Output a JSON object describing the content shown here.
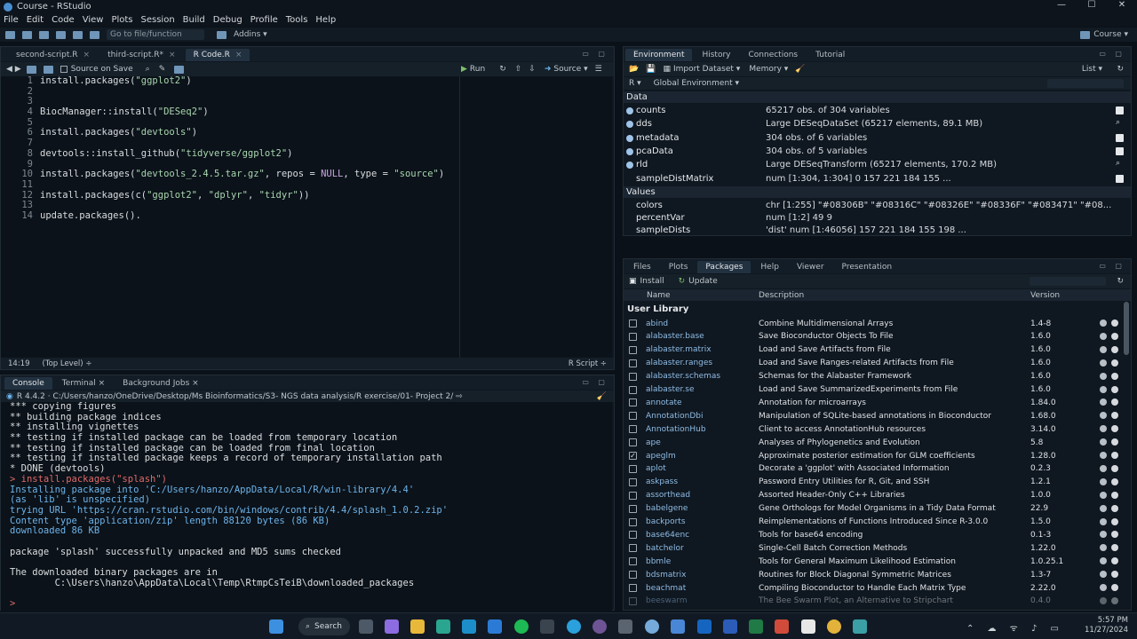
{
  "window": {
    "title": "Course - RStudio",
    "controls": [
      "—",
      "☐",
      "✕"
    ]
  },
  "menu": [
    "File",
    "Edit",
    "Code",
    "View",
    "Plots",
    "Session",
    "Build",
    "Debug",
    "Profile",
    "Tools",
    "Help"
  ],
  "toolbar": {
    "goto_placeholder": "Go to file/function",
    "addins": "Addins ▾",
    "project": "Course ▾"
  },
  "editor": {
    "tabs": [
      {
        "label": "second-script.R",
        "active": false
      },
      {
        "label": "third-script.R*",
        "active": false
      },
      {
        "label": "R Code.R",
        "active": true
      }
    ],
    "source_on_save": "Source on Save",
    "run": "Run",
    "source": "Source ▾",
    "lines": [
      {
        "n": "1",
        "code": "install.packages(\"ggplot2\")"
      },
      {
        "n": "2",
        "code": ""
      },
      {
        "n": "3",
        "code": ""
      },
      {
        "n": "4",
        "code": "BiocManager::install(\"DESeq2\")"
      },
      {
        "n": "5",
        "code": ""
      },
      {
        "n": "6",
        "code": "install.packages(\"devtools\")"
      },
      {
        "n": "7",
        "code": ""
      },
      {
        "n": "8",
        "code": "devtools::install_github(\"tidyverse/ggplot2\")"
      },
      {
        "n": "9",
        "code": ""
      },
      {
        "n": "10",
        "code": "install.packages(\"devtools_2.4.5.tar.gz\", repos = NULL, type = \"source\")"
      },
      {
        "n": "11",
        "code": ""
      },
      {
        "n": "12",
        "code": "install.packages(c(\"ggplot2\", \"dplyr\", \"tidyr\"))"
      },
      {
        "n": "13",
        "code": ""
      },
      {
        "n": "14",
        "code": "update.packages()."
      }
    ],
    "status": {
      "position": "14:19",
      "scope": "(Top Level) ÷",
      "type": "R Script ÷"
    }
  },
  "console": {
    "tabs": [
      {
        "label": "Console",
        "active": true
      },
      {
        "label": "Terminal ×",
        "active": false
      },
      {
        "label": "Background Jobs ×",
        "active": false
      }
    ],
    "path": "R 4.4.2 · C:/Users/hanzo/OneDrive/Desktop/Ms Bioinformatics/S3- NGS data analysis/R exercise/01- Project 2/ ⇨",
    "lines": [
      {
        "text": "*** copying figures",
        "cls": "c-white"
      },
      {
        "text": "** building package indices",
        "cls": "c-white"
      },
      {
        "text": "** installing vignettes",
        "cls": "c-white"
      },
      {
        "text": "** testing if installed package can be loaded from temporary location",
        "cls": "c-white"
      },
      {
        "text": "** testing if installed package can be loaded from final location",
        "cls": "c-white"
      },
      {
        "text": "** testing if installed package keeps a record of temporary installation path",
        "cls": "c-white"
      },
      {
        "text": "* DONE (devtools)",
        "cls": "c-white"
      },
      {
        "text": "> install.packages(\"splash\")",
        "cls": "c-red"
      },
      {
        "text": "Installing package into 'C:/Users/hanzo/AppData/Local/R/win-library/4.4'",
        "cls": "c-blue"
      },
      {
        "text": "(as 'lib' is unspecified)",
        "cls": "c-blue"
      },
      {
        "text": "trying URL 'https://cran.rstudio.com/bin/windows/contrib/4.4/splash_1.0.2.zip'",
        "cls": "c-blue"
      },
      {
        "text": "Content type 'application/zip' length 88120 bytes (86 KB)",
        "cls": "c-blue"
      },
      {
        "text": "downloaded 86 KB",
        "cls": "c-blue"
      },
      {
        "text": "",
        "cls": "c-white"
      },
      {
        "text": "package 'splash' successfully unpacked and MD5 sums checked",
        "cls": "c-white"
      },
      {
        "text": "",
        "cls": "c-white"
      },
      {
        "text": "The downloaded binary packages are in",
        "cls": "c-white"
      },
      {
        "text": "        C:\\Users\\hanzo\\AppData\\Local\\Temp\\RtmpCsTeiB\\downloaded_packages",
        "cls": "c-white"
      },
      {
        "text": "",
        "cls": "c-white"
      },
      {
        "text": "> ",
        "cls": "c-red"
      }
    ]
  },
  "environment": {
    "tabs": [
      {
        "label": "Environment",
        "active": true
      },
      {
        "label": "History",
        "active": false
      },
      {
        "label": "Connections",
        "active": false
      },
      {
        "label": "Tutorial",
        "active": false
      }
    ],
    "import_dataset": "Import Dataset ▾",
    "memory": "Memory ▾",
    "list_toggle": "List ▾",
    "r_select": "R ▾",
    "global_env": "Global Environment ▾",
    "data_header": "Data",
    "values_header": "Values",
    "data_rows": [
      {
        "name": "counts",
        "value": "65217 obs. of 304 variables",
        "right": "grid"
      },
      {
        "name": "dds",
        "value": "Large DESeqDataSet (65217 elements,  89.1 MB)",
        "right": "search"
      },
      {
        "name": "metadata",
        "value": "304 obs. of 6 variables",
        "right": "grid"
      },
      {
        "name": "pcaData",
        "value": "304 obs. of 5 variables",
        "right": "grid"
      },
      {
        "name": "rld",
        "value": "Large DESeqTransform (65217 elements,  170.2 MB)",
        "right": "search"
      },
      {
        "name": "sampleDistMatrix",
        "value": "num [1:304, 1:304] 0 157 221 184 155 ...",
        "right": "grid"
      }
    ],
    "value_rows": [
      {
        "name": "colors",
        "value": "chr [1:255] \"#08306B\" \"#08316C\" \"#08326E\" \"#08336F\" \"#083471\" \"#08..."
      },
      {
        "name": "percentVar",
        "value": "num [1:2] 49 9"
      },
      {
        "name": "sampleDists",
        "value": "'dist' num [1:46056] 157 221 184 155 198 ..."
      }
    ]
  },
  "packages": {
    "tabs": [
      {
        "label": "Files",
        "active": false
      },
      {
        "label": "Plots",
        "active": false
      },
      {
        "label": "Packages",
        "active": true
      },
      {
        "label": "Help",
        "active": false
      },
      {
        "label": "Viewer",
        "active": false
      },
      {
        "label": "Presentation",
        "active": false
      }
    ],
    "install": "Install",
    "update": "Update",
    "columns": {
      "name": "Name",
      "description": "Description",
      "version": "Version"
    },
    "section": "User Library",
    "rows": [
      {
        "name": "abind",
        "desc": "Combine Multidimensional Arrays",
        "ver": "1.4-8",
        "checked": false
      },
      {
        "name": "alabaster.base",
        "desc": "Save Bioconductor Objects To File",
        "ver": "1.6.0",
        "checked": false
      },
      {
        "name": "alabaster.matrix",
        "desc": "Load and Save Artifacts from File",
        "ver": "1.6.0",
        "checked": false
      },
      {
        "name": "alabaster.ranges",
        "desc": "Load and Save Ranges-related Artifacts from File",
        "ver": "1.6.0",
        "checked": false
      },
      {
        "name": "alabaster.schemas",
        "desc": "Schemas for the Alabaster Framework",
        "ver": "1.6.0",
        "checked": false
      },
      {
        "name": "alabaster.se",
        "desc": "Load and Save SummarizedExperiments from File",
        "ver": "1.6.0",
        "checked": false
      },
      {
        "name": "annotate",
        "desc": "Annotation for microarrays",
        "ver": "1.84.0",
        "checked": false
      },
      {
        "name": "AnnotationDbi",
        "desc": "Manipulation of SQLite-based annotations in Bioconductor",
        "ver": "1.68.0",
        "checked": false
      },
      {
        "name": "AnnotationHub",
        "desc": "Client to access AnnotationHub resources",
        "ver": "3.14.0",
        "checked": false
      },
      {
        "name": "ape",
        "desc": "Analyses of Phylogenetics and Evolution",
        "ver": "5.8",
        "checked": false
      },
      {
        "name": "apeglm",
        "desc": "Approximate posterior estimation for GLM coefficients",
        "ver": "1.28.0",
        "checked": true
      },
      {
        "name": "aplot",
        "desc": "Decorate a 'ggplot' with Associated Information",
        "ver": "0.2.3",
        "checked": false
      },
      {
        "name": "askpass",
        "desc": "Password Entry Utilities for R, Git, and SSH",
        "ver": "1.2.1",
        "checked": false
      },
      {
        "name": "assorthead",
        "desc": "Assorted Header-Only C++ Libraries",
        "ver": "1.0.0",
        "checked": false
      },
      {
        "name": "babelgene",
        "desc": "Gene Orthologs for Model Organisms in a Tidy Data Format",
        "ver": "22.9",
        "checked": false
      },
      {
        "name": "backports",
        "desc": "Reimplementations of Functions Introduced Since R-3.0.0",
        "ver": "1.5.0",
        "checked": false
      },
      {
        "name": "base64enc",
        "desc": "Tools for base64 encoding",
        "ver": "0.1-3",
        "checked": false
      },
      {
        "name": "batchelor",
        "desc": "Single-Cell Batch Correction Methods",
        "ver": "1.22.0",
        "checked": false
      },
      {
        "name": "bbmle",
        "desc": "Tools for General Maximum Likelihood Estimation",
        "ver": "1.0.25.1",
        "checked": false
      },
      {
        "name": "bdsmatrix",
        "desc": "Routines for Block Diagonal Symmetric Matrices",
        "ver": "1.3-7",
        "checked": false
      },
      {
        "name": "beachmat",
        "desc": "Compiling Bioconductor to Handle Each Matrix Type",
        "ver": "2.22.0",
        "checked": false
      },
      {
        "name": "beeswarm",
        "desc": "The Bee Swarm Plot, an Alternative to Stripchart",
        "ver": "0.4.0",
        "checked": false
      }
    ]
  },
  "taskbar": {
    "search": "Search",
    "time": "5:57 PM",
    "date": "11/27/2024"
  }
}
